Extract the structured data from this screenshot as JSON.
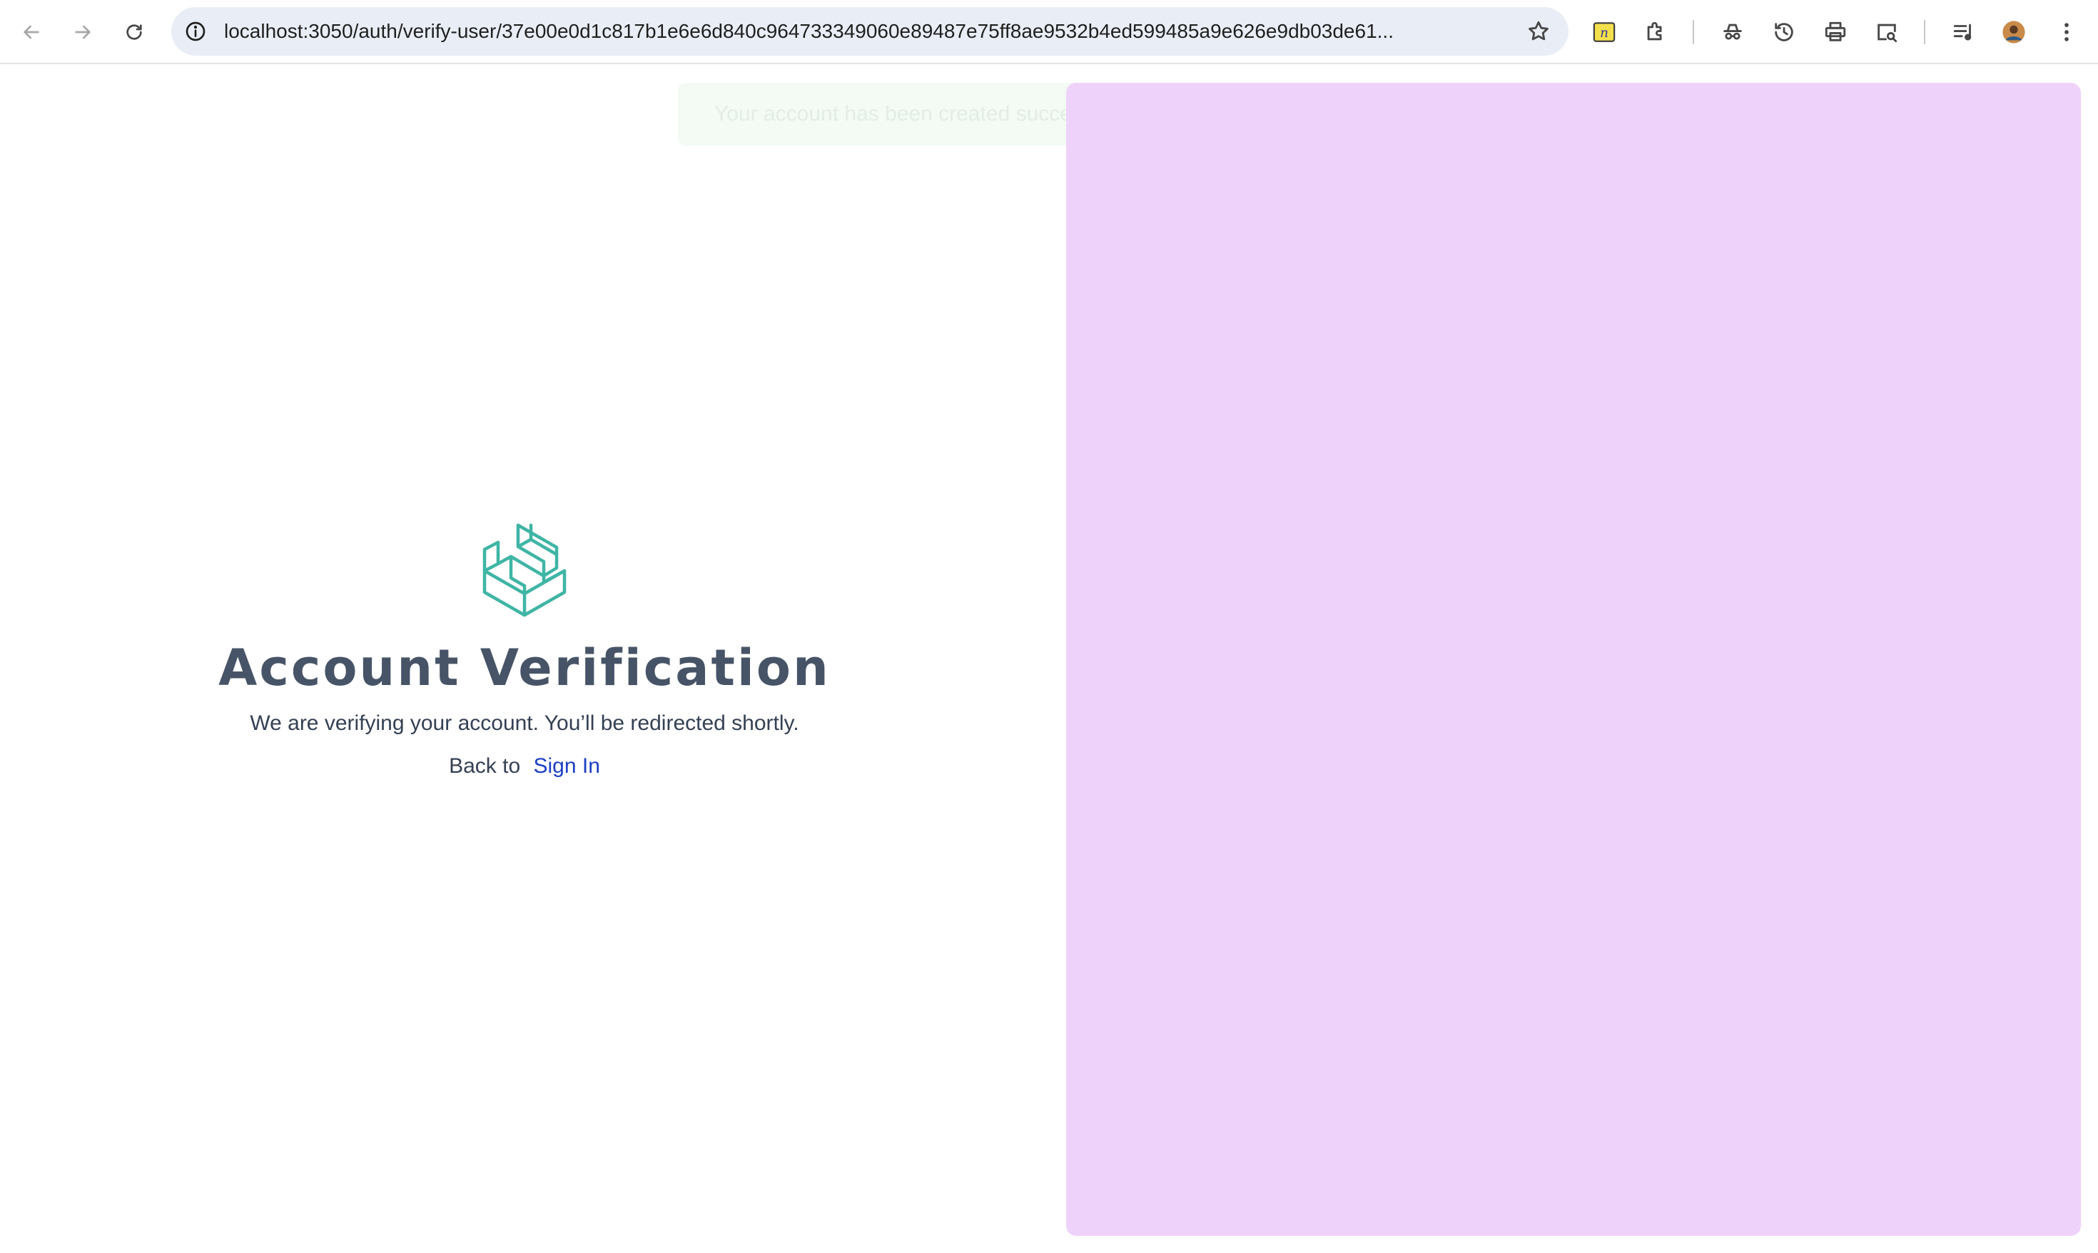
{
  "browser": {
    "url": "localhost:3050/auth/verify-user/37e00e0d1c817b1e6e6d840c964733349060e89487e75ff8ae9532b4ed599485a9e626e9db03de61...",
    "icons": {
      "back": "arrow-left-icon",
      "forward": "arrow-right-icon",
      "reload": "reload-icon",
      "site_info": "info-icon",
      "bookmark": "star-icon",
      "extension_1": "notes-extension-icon",
      "extensions": "puzzle-icon",
      "incognito": "incognito-icon",
      "history": "history-icon",
      "print": "printer-icon",
      "search_tabs": "tab-search-icon",
      "media": "media-control-icon",
      "profile": "avatar",
      "menu": "kebab-menu-icon"
    }
  },
  "toast": {
    "message": "Your account has been created successfully. Please log in to continue."
  },
  "verification": {
    "title": "Account Verification",
    "subtitle": "We are verifying your account. You’ll be redirected shortly.",
    "back_prefix": "Back to",
    "sign_in_link": "Sign In"
  },
  "colors": {
    "accent_teal": "#3fb5a5",
    "link_blue": "#1d3fc4",
    "panel_pink": "#efd2f9",
    "title_gray": "#475467"
  }
}
